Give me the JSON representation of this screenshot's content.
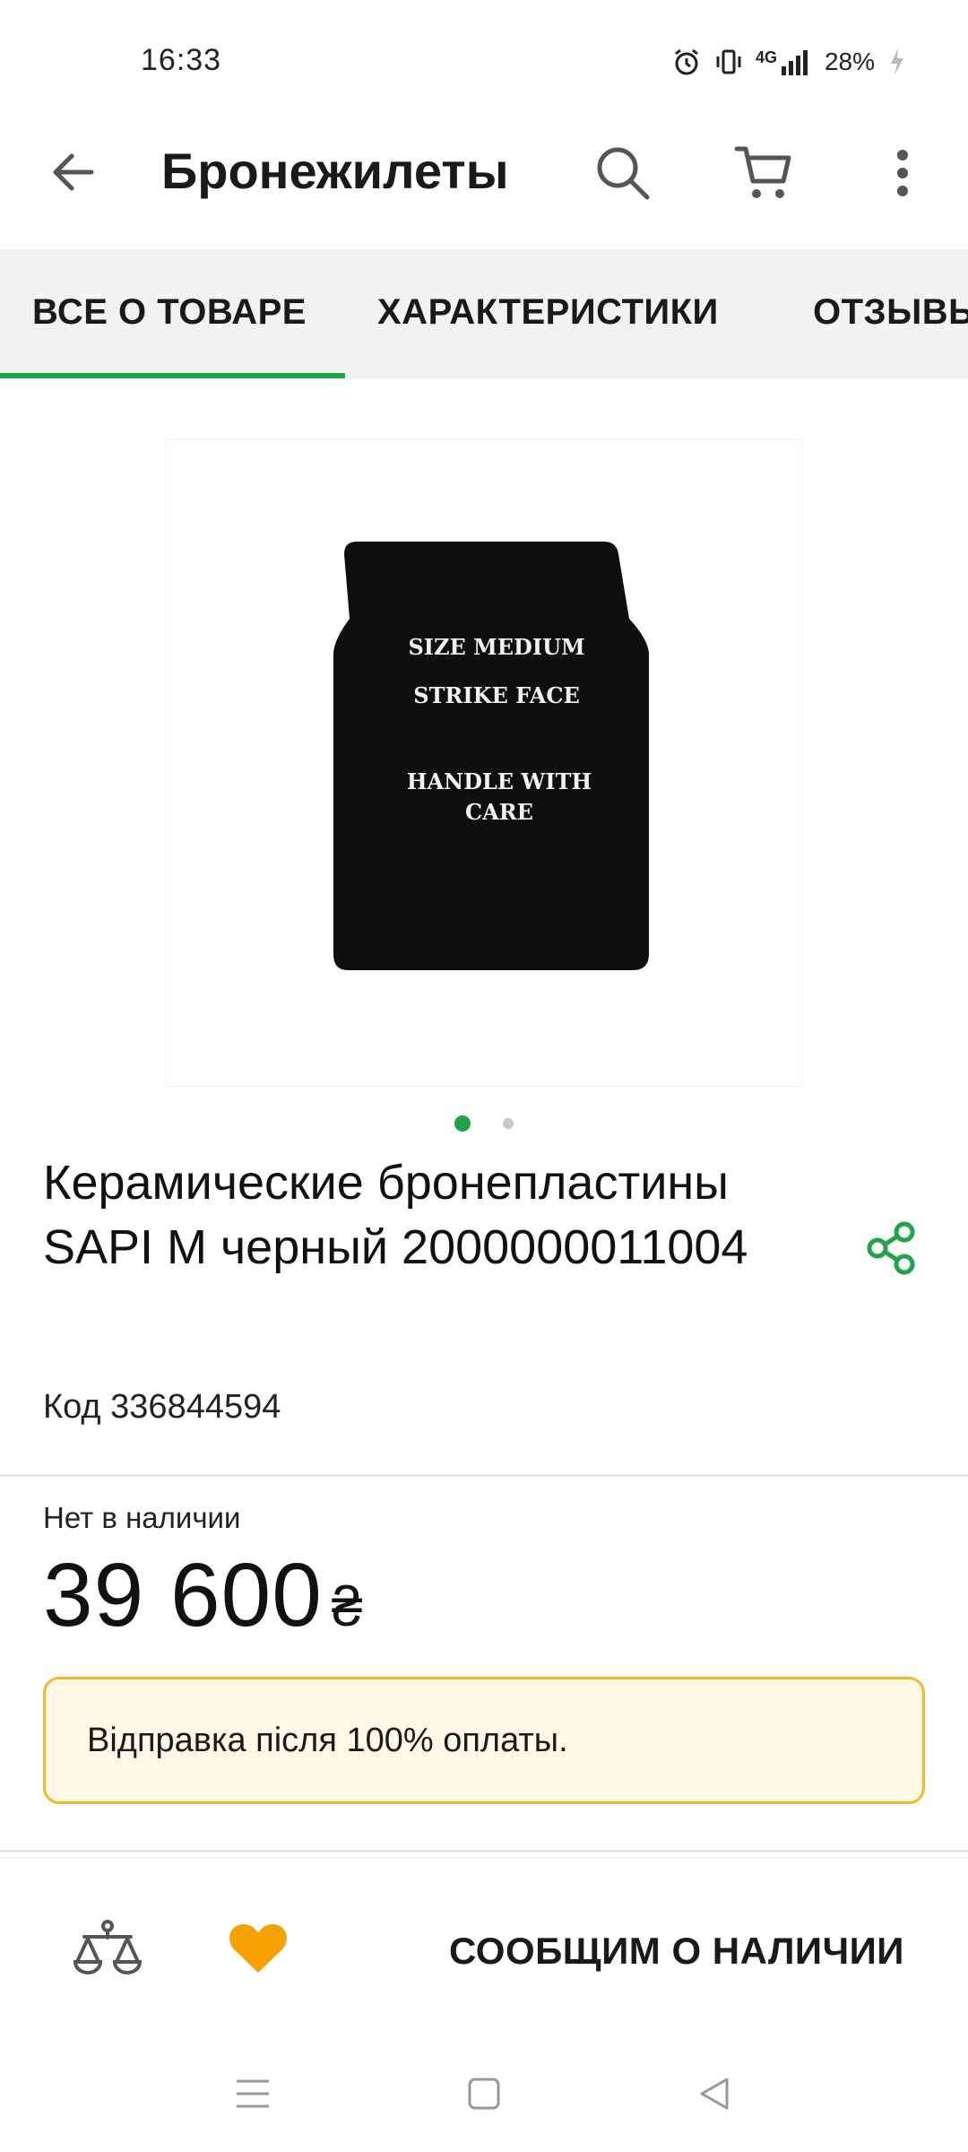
{
  "status_bar": {
    "time": "16:33",
    "network": "4G",
    "battery": "28%",
    "icons": [
      "alarm-icon",
      "vibrate-icon",
      "signal-icon",
      "battery-charging-icon"
    ]
  },
  "app_bar": {
    "title": "Бронежилеты",
    "icons": [
      "back-arrow-icon",
      "search-icon",
      "cart-icon",
      "more-vert-icon"
    ]
  },
  "tabs": [
    {
      "label": "ВСЕ О ТОВАРЕ",
      "active": true
    },
    {
      "label": "ХАРАКТЕРИСТИКИ",
      "active": false
    },
    {
      "label": "ОТЗЫВЫ",
      "active": false
    }
  ],
  "gallery": {
    "plate_lines": [
      "SIZE MEDIUM",
      "STRIKE FACE",
      "HANDLE WITH",
      "CARE"
    ],
    "images_count": 2,
    "active_index": 0
  },
  "product": {
    "title": "Керамические бронепластины SAPI M черный 2000000011004",
    "code": "Код 336844594"
  },
  "pricing": {
    "availability": "Нет в наличии",
    "price": "39 600",
    "currency": "₴"
  },
  "notice": {
    "text": "Відправка після 100% оплаты."
  },
  "bottom_bar": {
    "notify_label": "СООБЩИМ О НАЛИЧИИ",
    "icons": [
      "compare-scales-icon",
      "favorite-heart-icon"
    ]
  },
  "colors": {
    "accent_green": "#21a34a",
    "heart_orange": "#f5a100",
    "notice_border": "#f0b82a",
    "notice_bg": "#fff8e6"
  }
}
